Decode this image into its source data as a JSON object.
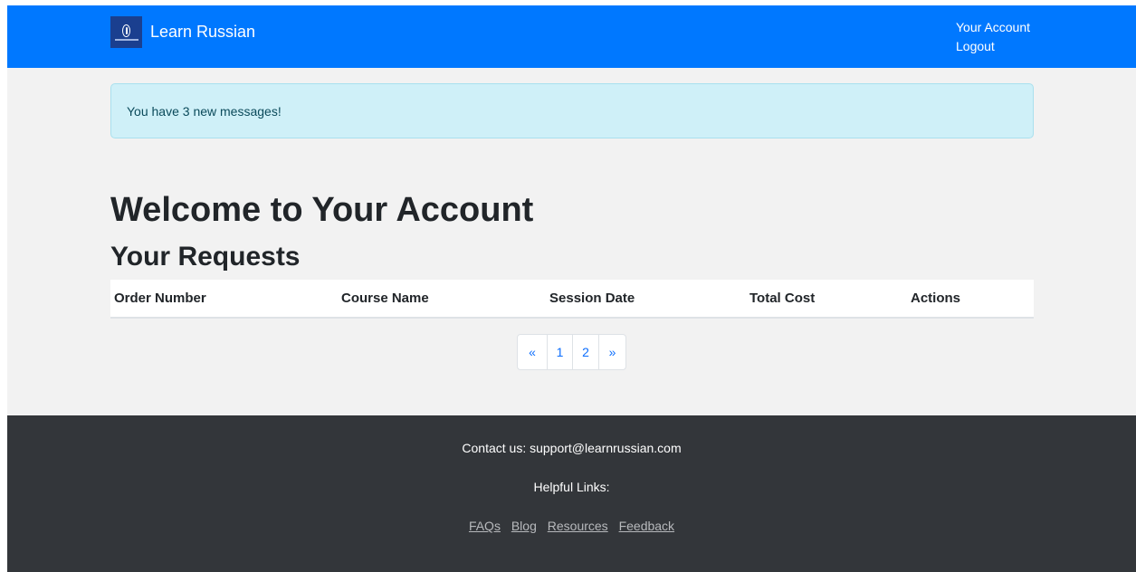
{
  "navbar": {
    "brand_name": "Learn Russian",
    "logo_icon": "oval-emblem-icon",
    "links": [
      "Your Account",
      "Logout"
    ]
  },
  "alert": {
    "message": "You have 3 new messages!"
  },
  "main": {
    "title": "Welcome to Your Account",
    "requests_heading": "Your Requests",
    "table": {
      "columns": [
        "Order Number",
        "Course Name",
        "Session Date",
        "Total Cost",
        "Actions"
      ],
      "rows": []
    },
    "pagination": {
      "prev": "«",
      "pages": [
        "1",
        "2"
      ],
      "next": "»"
    }
  },
  "footer": {
    "contact": "Contact us: support@learnrussian.com",
    "helpful_links_label": "Helpful Links:",
    "links": [
      "FAQs",
      "Blog",
      "Resources",
      "Feedback"
    ]
  },
  "colors": {
    "navbar": "#0078ff",
    "alert_bg": "#cff0f8",
    "footer_bg": "#33363a",
    "link": "#0d6efd"
  }
}
